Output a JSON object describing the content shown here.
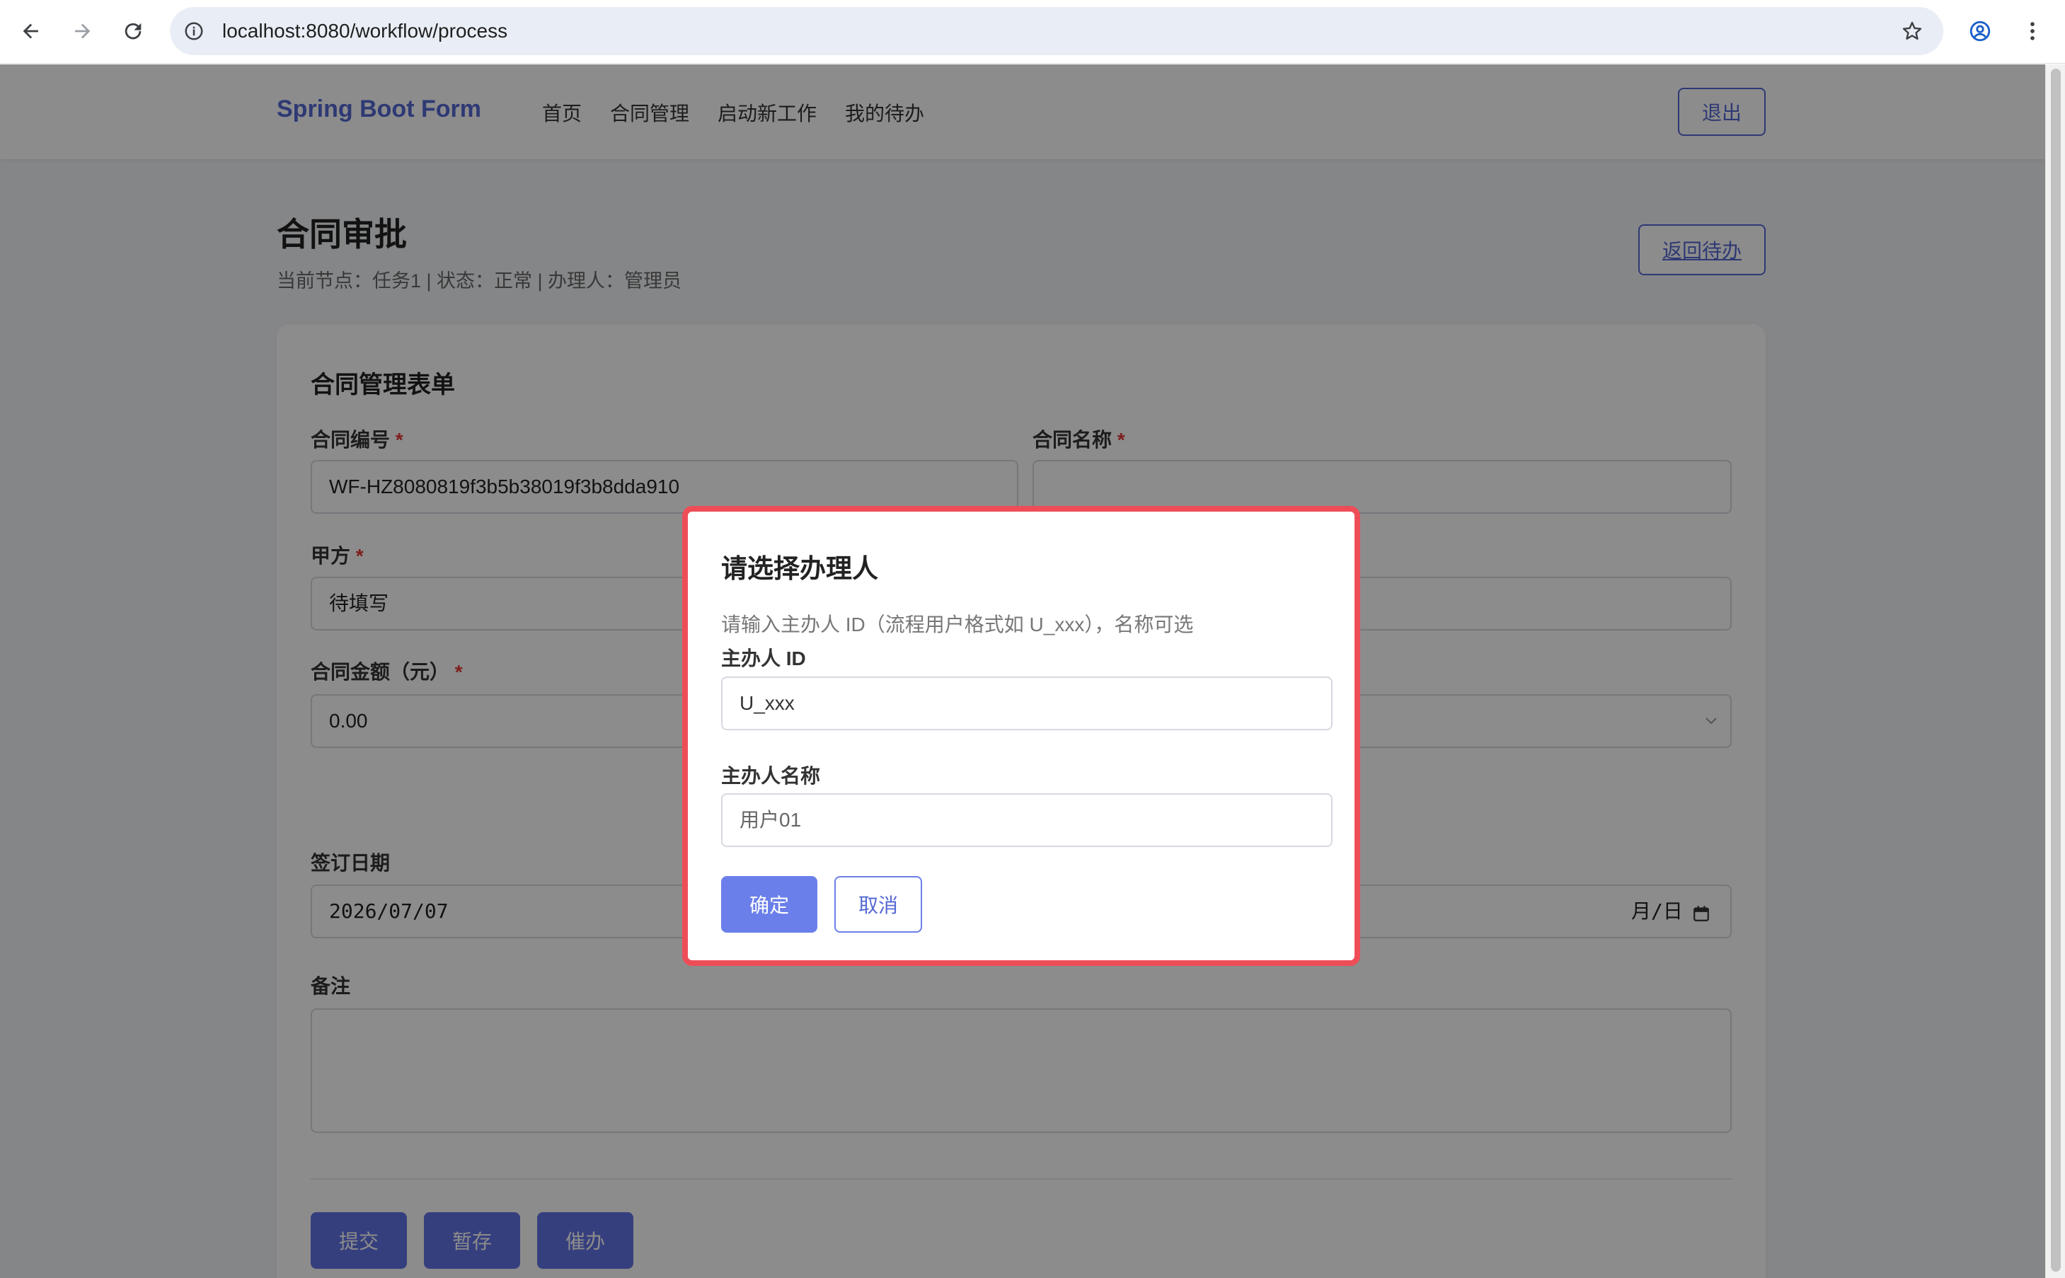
{
  "browser": {
    "url": "localhost:8080/workflow/process",
    "icons": [
      "back-icon",
      "forward-icon",
      "reload-icon",
      "info-icon",
      "star-icon",
      "profile-icon",
      "more-vert-icon"
    ]
  },
  "app": {
    "brand": "Spring Boot Form",
    "nav": [
      "首页",
      "合同管理",
      "启动新工作",
      "我的待办"
    ],
    "logout": "退出"
  },
  "header": {
    "title": "合同审批",
    "subtitle": "当前节点：任务1 | 状态：正常 | 办理人：管理员",
    "back_button": "返回待办"
  },
  "form": {
    "title": "合同管理表单",
    "required_mark": "*",
    "contract_no": {
      "label": "合同编号",
      "value": "WF-HZ8080819f3b5b38019f3b8dda910"
    },
    "contract_name": {
      "label": "合同名称"
    },
    "party_a": {
      "label": "甲方",
      "value": "待填写"
    },
    "amount": {
      "label": "合同金额（元）",
      "value": "0.00"
    },
    "sign_date": {
      "label": "签订日期",
      "value": "2026/07/07"
    },
    "end_date_tail": "月/日",
    "remark": {
      "label": "备注",
      "value": ""
    },
    "buttons": {
      "submit": "提交",
      "save": "暂存",
      "urge": "催办"
    }
  },
  "modal": {
    "title": "请选择办理人",
    "hint": "请输入主办人 ID（流程用户格式如 U_xxx），名称可选",
    "id_label": "主办人 ID",
    "id_placeholder": "U_xxx",
    "name_label": "主办人名称",
    "name_value": "用户01",
    "confirm": "确定",
    "cancel": "取消"
  },
  "colors": {
    "accent": "#5468d4",
    "modal_highlight": "#ee4d58",
    "overlay": "rgba(0,0,0,0.45)"
  }
}
